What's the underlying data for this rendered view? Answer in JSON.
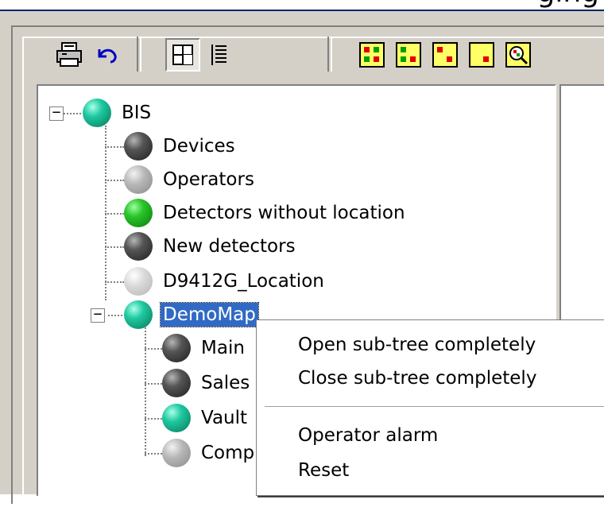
{
  "window": {
    "title_fragment": "ging"
  },
  "toolbar": {
    "buttons": [
      {
        "icon": "printer-icon"
      },
      {
        "icon": "undo-icon"
      },
      {
        "icon": "tree-view-icon",
        "pressed": true
      },
      {
        "icon": "list-view-icon"
      },
      {
        "icon": "all-states-icon"
      },
      {
        "icon": "state-filter-1-icon"
      },
      {
        "icon": "state-filter-2-icon"
      },
      {
        "icon": "state-filter-3-icon"
      },
      {
        "icon": "zoom-icon"
      }
    ]
  },
  "tree": {
    "root": {
      "label": "BIS",
      "color": "teal"
    },
    "children": [
      {
        "label": "Devices",
        "color": "dark"
      },
      {
        "label": "Operators",
        "color": "gray"
      },
      {
        "label": "Detectors without location",
        "color": "green"
      },
      {
        "label": "New detectors",
        "color": "dark"
      },
      {
        "label": "D9412G_Location",
        "color": "lgray"
      },
      {
        "label": "DemoMap",
        "color": "teal",
        "selected": true,
        "expanded": true
      }
    ],
    "demomap_children": [
      {
        "label": "Main",
        "color": "dark"
      },
      {
        "label": "Sales",
        "color": "dark"
      },
      {
        "label": "Vault",
        "color": "teal"
      },
      {
        "label": "Comp",
        "color": "gray"
      }
    ]
  },
  "context_menu": {
    "items": [
      "Open sub-tree completely",
      "Close sub-tree completely",
      "Operator alarm",
      "Reset"
    ]
  },
  "colors": {
    "selection": "#316ac5",
    "titlebar": "#0a246a",
    "chrome": "#d4d0c8"
  }
}
